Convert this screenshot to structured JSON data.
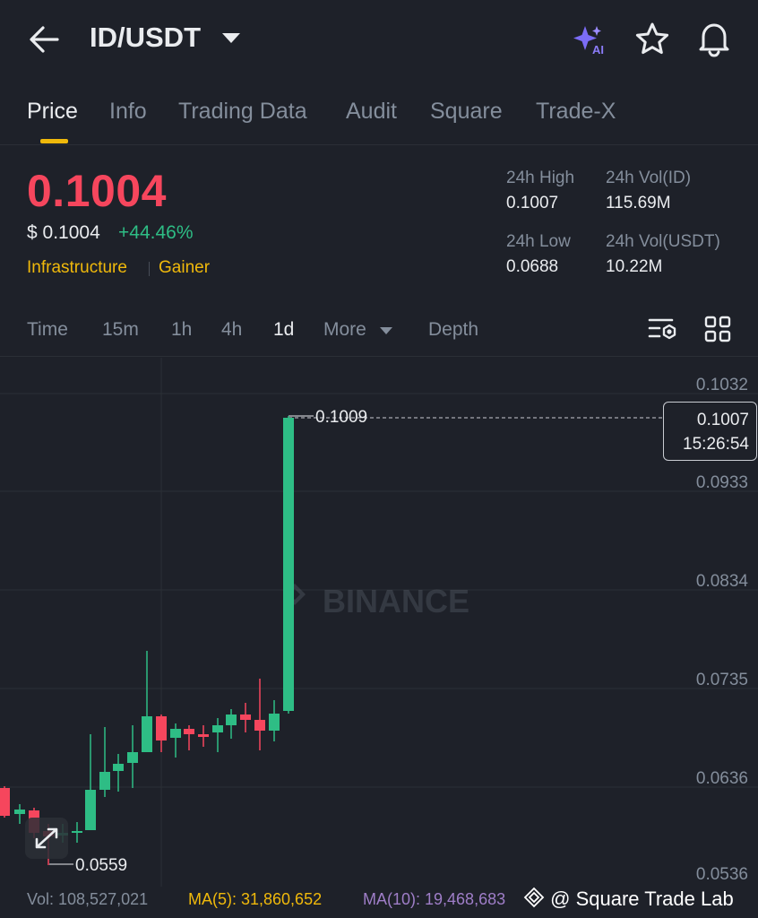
{
  "header": {
    "pair": "ID/USDT",
    "icons": [
      "back-arrow-icon",
      "ai-sparkle-icon",
      "star-icon",
      "bell-icon"
    ],
    "ai_label": "AI"
  },
  "tabs": [
    {
      "label": "Price",
      "active": true
    },
    {
      "label": "Info"
    },
    {
      "label": "Trading Data"
    },
    {
      "label": "Audit"
    },
    {
      "label": "Square"
    },
    {
      "label": "Trade-X"
    }
  ],
  "price": {
    "last": "0.1004",
    "usd": "$ 0.1004",
    "change": "+44.46%",
    "tags": [
      "Infrastructure",
      "Gainer"
    ]
  },
  "stats": {
    "high_label": "24h High",
    "high_value": "0.1007",
    "vol_id_label": "24h Vol(ID)",
    "vol_id_value": "115.69M",
    "low_label": "24h Low",
    "low_value": "0.0688",
    "vol_usdt_label": "24h Vol(USDT)",
    "vol_usdt_value": "10.22M"
  },
  "intervals": {
    "items": [
      "Time",
      "15m",
      "1h",
      "4h",
      "1d",
      "More",
      "Depth"
    ],
    "active": "1d"
  },
  "chart": {
    "y_labels": [
      "0.1032",
      "0.0933",
      "0.0834",
      "0.0735",
      "0.0636",
      "0.0536"
    ],
    "high_marker": "0.1009",
    "low_marker": "0.0559",
    "current_price": "0.1007",
    "countdown": "15:26:54",
    "watermark": "BINANCE"
  },
  "colors": {
    "up": "#2ebd85",
    "down": "#f6465d",
    "accent": "#f0b90b",
    "ma10": "#9f7ec8"
  },
  "footer": {
    "vol": "Vol: 108,527,021",
    "ma5": "MA(5): 31,860,652",
    "ma10": "MA(10): 19,468,683",
    "credit": "@ Square Trade Lab"
  }
}
